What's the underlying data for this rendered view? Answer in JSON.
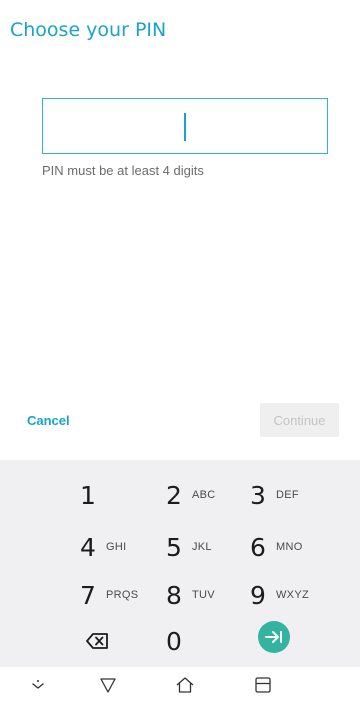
{
  "header": {
    "title": "Choose your PIN"
  },
  "pin": {
    "value": "",
    "hint": "PIN must be at least 4 digits"
  },
  "actions": {
    "cancel_label": "Cancel",
    "continue_label": "Continue"
  },
  "keypad": {
    "keys": [
      {
        "digit": "1",
        "letters": ""
      },
      {
        "digit": "2",
        "letters": "ABC"
      },
      {
        "digit": "3",
        "letters": "DEF"
      },
      {
        "digit": "4",
        "letters": "GHI"
      },
      {
        "digit": "5",
        "letters": "JKL"
      },
      {
        "digit": "6",
        "letters": "MNO"
      },
      {
        "digit": "7",
        "letters": "PRQS"
      },
      {
        "digit": "8",
        "letters": "TUV"
      },
      {
        "digit": "9",
        "letters": "WXYZ"
      },
      {
        "digit": "0",
        "letters": ""
      }
    ],
    "accent_color": "#33b3a0"
  },
  "navbar": {
    "icons": [
      "hide-keyboard-icon",
      "back-icon",
      "home-icon",
      "recents-icon"
    ]
  },
  "colors": {
    "accent": "#1aa3c9"
  }
}
